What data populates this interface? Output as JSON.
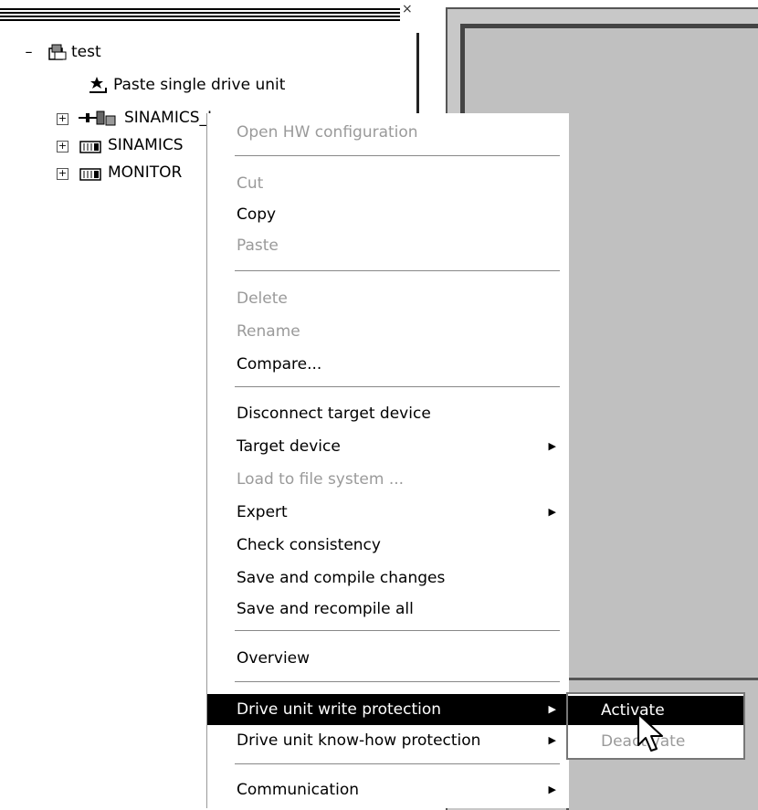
{
  "tree": {
    "close_glyph": "×",
    "items": [
      {
        "label": "test",
        "expander": "–"
      },
      {
        "label": "Paste single drive unit"
      },
      {
        "label": "SINAMICS_INTE",
        "expander": "+"
      },
      {
        "label": "SINAMICS",
        "expander": "+"
      },
      {
        "label": "MONITOR",
        "expander": "+"
      }
    ]
  },
  "context_menu": {
    "items": [
      {
        "label": "Open HW configuration",
        "state": "disabled"
      },
      {
        "label": "Cut",
        "state": "disabled"
      },
      {
        "label": "Copy",
        "state": "enabled"
      },
      {
        "label": "Paste",
        "state": "disabled"
      },
      {
        "label": "Delete",
        "state": "disabled"
      },
      {
        "label": "Rename",
        "state": "disabled"
      },
      {
        "label": "Compare...",
        "state": "enabled"
      },
      {
        "label": "Disconnect target device",
        "state": "enabled"
      },
      {
        "label": "Target device",
        "state": "enabled",
        "submenu": true
      },
      {
        "label": "Load to file system ...",
        "state": "disabled"
      },
      {
        "label": "Expert",
        "state": "enabled",
        "submenu": true
      },
      {
        "label": "Check consistency",
        "state": "enabled"
      },
      {
        "label": "Save and compile changes",
        "state": "enabled"
      },
      {
        "label": "Save and recompile all",
        "state": "enabled"
      },
      {
        "label": "Overview",
        "state": "enabled"
      },
      {
        "label": "Drive unit write protection",
        "state": "highlighted",
        "submenu": true
      },
      {
        "label": "Drive unit know-how protection",
        "state": "enabled",
        "submenu": true
      },
      {
        "label": "Communication",
        "state": "enabled",
        "submenu": true
      }
    ],
    "submenu_arrow": "▶"
  },
  "submenu": {
    "items": [
      {
        "label": "Activate",
        "state": "highlighted"
      },
      {
        "label": "Deactivate",
        "state": "disabled"
      }
    ]
  },
  "colors": {
    "highlight_bg": "#000000",
    "highlight_fg": "#ffffff",
    "disabled_fg": "#9a9a9a",
    "workspace_bg": "#c0c0c0"
  }
}
